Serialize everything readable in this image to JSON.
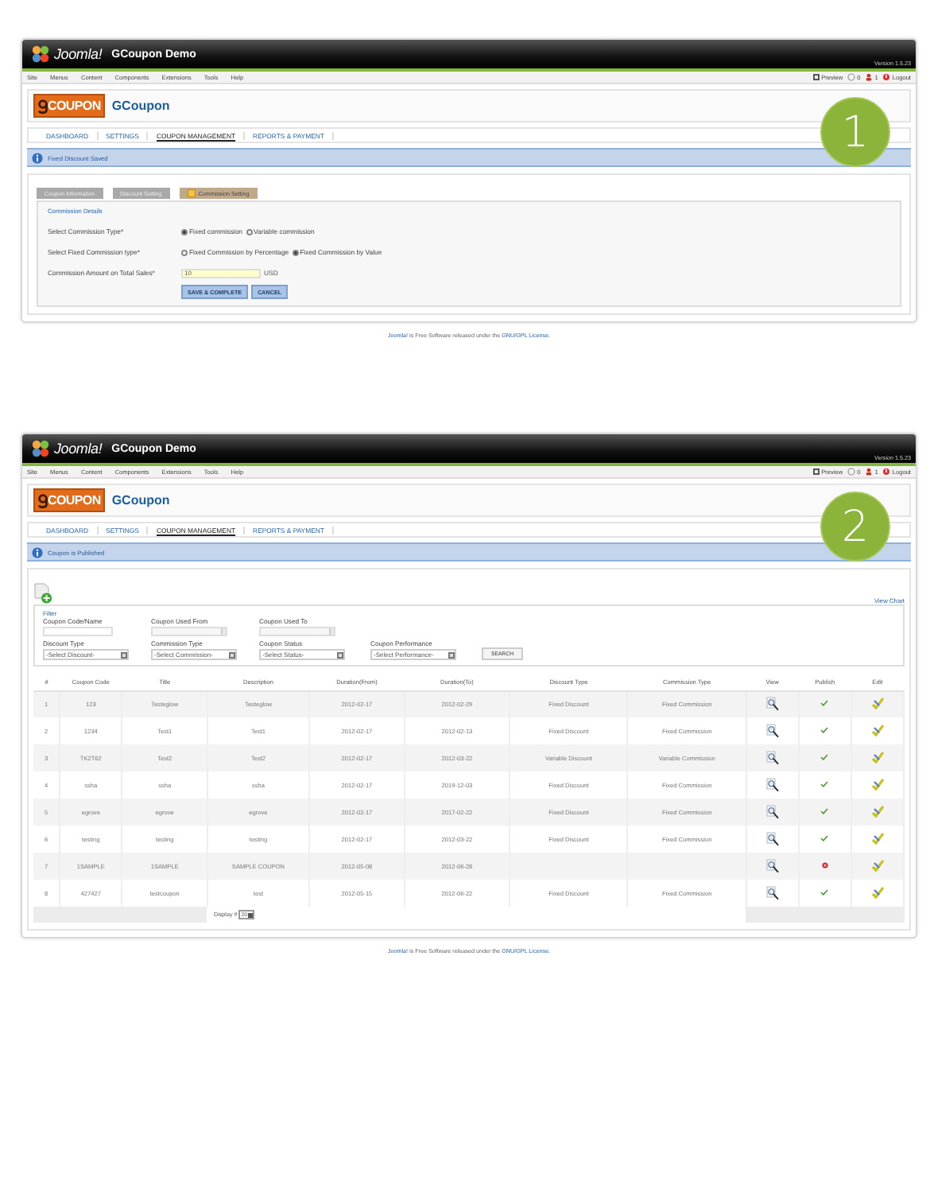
{
  "screens": [
    {
      "badge": "1",
      "header": {
        "logo": "Joomla!",
        "site": "GCoupon Demo",
        "version": "Version 1.5.23"
      },
      "menu": [
        "Site",
        "Menus",
        "Content",
        "Components",
        "Extensions",
        "Tools",
        "Help"
      ],
      "status": [
        {
          "kind": "preview",
          "label": "Preview"
        },
        {
          "kind": "messages",
          "label": "0"
        },
        {
          "kind": "users",
          "label": "1"
        },
        {
          "kind": "logout",
          "label": "Logout"
        }
      ],
      "component": {
        "logo": "COUPON",
        "title": "GCoupon"
      },
      "nav": [
        {
          "label": "DASHBOARD",
          "selected": false
        },
        {
          "label": "SETTINGS",
          "selected": false
        },
        {
          "label": "COUPON MANAGEMENT",
          "selected": true
        },
        {
          "label": "REPORTS & PAYMENT",
          "selected": false
        }
      ],
      "message": "Fixed Discount Saved",
      "content": {
        "kind": "form",
        "tabs": [
          {
            "label": "Coupon Information",
            "selected": false
          },
          {
            "label": "Discount Setting",
            "selected": false
          },
          {
            "label": "Commission Setting",
            "selected": true
          }
        ],
        "legend": "Commission Details",
        "rows": [
          {
            "kind": "radio",
            "label": "Select Commission Type*",
            "options": [
              {
                "label": "Fixed commission",
                "selected": true
              },
              {
                "label": "Variable commission",
                "selected": false
              }
            ]
          },
          {
            "kind": "radio",
            "label": "Select Fixed Commission type*",
            "options": [
              {
                "label": "Fixed Commission by Percentage",
                "selected": false
              },
              {
                "label": "Fixed Commission by Value",
                "selected": true
              }
            ]
          },
          {
            "kind": "amount",
            "label": "Commission Amount on Total Sales*",
            "value": "10",
            "unit": "USD"
          }
        ],
        "buttons": [
          "SAVE & COMPLETE",
          "CANCEL"
        ]
      },
      "footer": {
        "project_link": "Joomla!",
        "text": " is Free Software released under the ",
        "license_link": "GNU/GPL License",
        "end": "."
      }
    },
    {
      "badge": "2",
      "header": {
        "logo": "Joomla!",
        "site": "GCoupon Demo",
        "version": "Version 1.5.23"
      },
      "menu": [
        "Site",
        "Menus",
        "Content",
        "Components",
        "Extensions",
        "Tools",
        "Help"
      ],
      "status": [
        {
          "kind": "preview",
          "label": "Preview"
        },
        {
          "kind": "messages",
          "label": "0"
        },
        {
          "kind": "users",
          "label": "1"
        },
        {
          "kind": "logout",
          "label": "Logout"
        }
      ],
      "component": {
        "logo": "COUPON",
        "title": "GCoupon"
      },
      "nav": [
        {
          "label": "DASHBOARD",
          "selected": false
        },
        {
          "label": "SETTINGS",
          "selected": false
        },
        {
          "label": "COUPON MANAGEMENT",
          "selected": true
        },
        {
          "label": "REPORTS & PAYMENT",
          "selected": false
        }
      ],
      "message": "Coupon is Published",
      "content": {
        "kind": "list",
        "view_chart": "View Chart",
        "filter": {
          "legend": "Filter",
          "fields": [
            {
              "kind": "text",
              "label": "Coupon Code/Name"
            },
            {
              "kind": "date",
              "label": "Coupon Used From"
            },
            {
              "kind": "date",
              "label": "Coupon Used To"
            },
            {
              "kind": "select",
              "label": "Discount Type",
              "value": "-Select Discount-"
            },
            {
              "kind": "select",
              "label": "Commission Type",
              "value": "-Select Commission-"
            },
            {
              "kind": "select",
              "label": "Coupon Status",
              "value": "-Select Status-"
            },
            {
              "kind": "select",
              "label": "Coupon Performance",
              "value": "-Select Performance-"
            }
          ],
          "search": "SEARCH"
        },
        "columns": [
          "#",
          "Coupon Code",
          "Title",
          "Description",
          "Duration(From)",
          "Duration(To)",
          "Discount Type",
          "Commission Type",
          "View",
          "Publish",
          "Edit"
        ],
        "rows": [
          {
            "cells": [
              "1",
              "123",
              "Testeglow",
              "Testeglow",
              "2012-02-17",
              "2012-02-29",
              "Fixed Discount",
              "Fixed Commission"
            ],
            "published": true
          },
          {
            "cells": [
              "2",
              "1234",
              "Test1",
              "Test1",
              "2012-02-17",
              "2012-02-13",
              "Fixed Discount",
              "Fixed Commission"
            ],
            "published": true
          },
          {
            "cells": [
              "3",
              "TK2T62",
              "Test2",
              "Test2",
              "2012-02-17",
              "2012-03-22",
              "Variable Discount",
              "Variable Commission"
            ],
            "published": true
          },
          {
            "cells": [
              "4",
              "ssha",
              "ssha",
              "ssha",
              "2012-02-17",
              "2019-12-03",
              "Fixed Discount",
              "Fixed Commission"
            ],
            "published": true
          },
          {
            "cells": [
              "5",
              "egrove",
              "egrove",
              "egrove",
              "2012-02-17",
              "2017-02-22",
              "Fixed Discount",
              "Fixed Commission"
            ],
            "published": true
          },
          {
            "cells": [
              "6",
              "testing",
              "testing",
              "testing",
              "2012-02-17",
              "2012-03-22",
              "Fixed Discount",
              "Fixed Commission"
            ],
            "published": true
          },
          {
            "cells": [
              "7",
              "1SAMPLE",
              "1SAMPLE",
              "SAMPLE COUPON",
              "2012-05-08",
              "2012-06-28",
              "",
              ""
            ],
            "published": false
          },
          {
            "cells": [
              "8",
              "427427",
              "testcoupon",
              "test",
              "2012-05-15",
              "2012-06-22",
              "Fixed Discount",
              "Fixed Commission"
            ],
            "published": true
          }
        ],
        "display": {
          "label": "Display #",
          "value": "20"
        }
      },
      "footer": {
        "project_link": "Joomla!",
        "text": " is Free Software released under the ",
        "license_link": "GNU/GPL License",
        "end": "."
      }
    }
  ]
}
